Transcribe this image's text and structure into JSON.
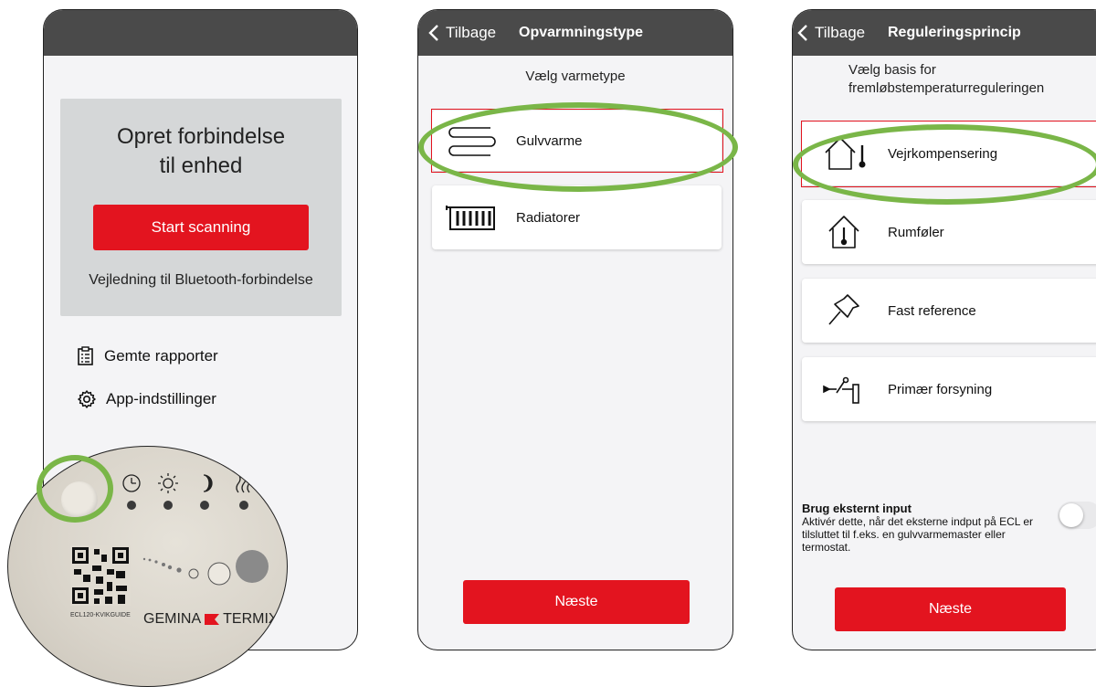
{
  "screen1": {
    "scan_title_line1": "Opret forbindelse",
    "scan_title_line2": "til enhed",
    "start_button": "Start scanning",
    "bluetooth_guide": "Vejledning til Bluetooth-forbindelse",
    "menu": [
      {
        "label": "Gemte rapporter",
        "icon": "report-icon"
      },
      {
        "label": "App-indstillinger",
        "icon": "gear-icon"
      }
    ],
    "device_photo": {
      "qr_caption": "ECL120-KVIKGUIDE",
      "brand_left": "GEMINA",
      "brand_right": "TERMIX"
    }
  },
  "screen2": {
    "back_label": "Tilbage",
    "title": "Opvarmningstype",
    "subtitle": "Vælg varmetype",
    "options": [
      {
        "label": "Gulvvarme",
        "icon": "floor-heating-icon",
        "highlighted": true
      },
      {
        "label": "Radiatorer",
        "icon": "radiator-icon",
        "highlighted": false
      }
    ],
    "next_button": "Næste"
  },
  "screen3": {
    "back_label": "Tilbage",
    "title": "Reguleringsprincip",
    "subtitle_line1": "Vælg basis for",
    "subtitle_line2": "fremløbstemperaturreguleringen",
    "options": [
      {
        "label": "Vejrkompensering",
        "icon": "house-thermometer-icon",
        "highlighted": true
      },
      {
        "label": "Rumføler",
        "icon": "room-sensor-icon",
        "highlighted": false
      },
      {
        "label": "Fast reference",
        "icon": "pushpin-icon",
        "highlighted": false
      },
      {
        "label": "Primær forsyning",
        "icon": "primary-supply-icon",
        "highlighted": false
      }
    ],
    "external_input_title": "Brug eksternt input",
    "external_input_desc": "Aktivér dette, når det eksterne indput på ECL er tilsluttet til f.eks. en gulvvarmemaster eller termostat.",
    "external_input_enabled": false,
    "next_button": "Næste"
  },
  "colors": {
    "accent_red": "#e3141f",
    "header_gray": "#4a4a4a",
    "highlight_green": "#7ab648"
  }
}
